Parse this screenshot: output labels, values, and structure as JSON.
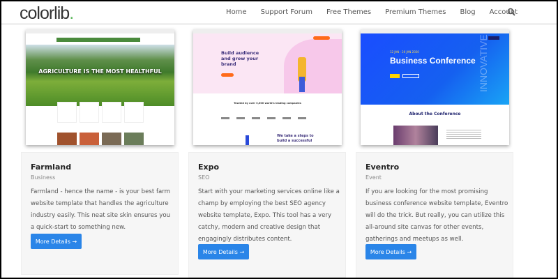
{
  "header": {
    "logo": "colorlib",
    "logo_dot": ".",
    "nav": [
      "Home",
      "Support Forum",
      "Free Themes",
      "Premium Themes",
      "Blog",
      "Account"
    ]
  },
  "cards": [
    {
      "title": "Farmland",
      "category": "Business",
      "description": "Farmland - hence the name - is your best farm website template that handles the agriculture industry easily. This neat site skin ensures you a quick-start to something new.",
      "button": "More Details →",
      "thumb": {
        "headline": "AGRICULTURE IS THE MOST HEALTHFUL"
      }
    },
    {
      "title": "Expo",
      "category": "SEO",
      "description": "Start with your marketing services online like a champ by employing the best SEO agency website template, Expo. This tool has a very catchy, modern and creative design that engagingly distributes content.",
      "button": "More Details →",
      "thumb": {
        "headline": "Build audience and grow your brand",
        "sub": "Trusted by over 3,000 world's leading companies",
        "bottom": "We take a steps to build a successful"
      }
    },
    {
      "title": "Eventro",
      "category": "Event",
      "description": "If you are looking for the most promising business conference website template, Eventro will do the trick. But really, you can utilize this all-around site canvas for other events, gatherings and meetups as well.",
      "button": "More Details →",
      "thumb": {
        "date": "12 JAN - 20 JAN 2020",
        "headline": "Business Conference",
        "side": "INNOVATIVE",
        "about": "About the Conference"
      }
    }
  ],
  "colors": {
    "accent": "#2a85e8",
    "logo_dot": "#5cb85c"
  }
}
